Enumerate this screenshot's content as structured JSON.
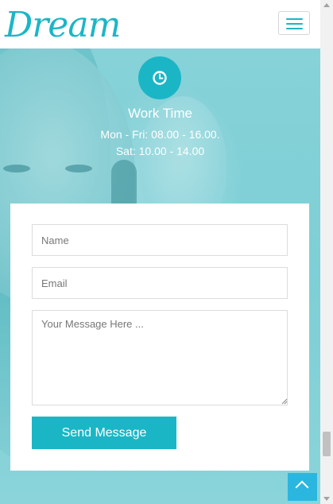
{
  "header": {
    "logo_text": "Dream",
    "menu_icon": "hamburger-menu-icon"
  },
  "info": {
    "icon": "clock-icon",
    "title": "Work Time",
    "line1": "Mon - Fri: 08.00 - 16.00.",
    "line2": "Sat: 10.00 - 14.00"
  },
  "form": {
    "name_placeholder": "Name",
    "email_placeholder": "Email",
    "message_placeholder": "Your Message Here ...",
    "submit_label": "Send Message"
  },
  "back_to_top": {
    "icon": "chevron-up-icon"
  },
  "colors": {
    "accent": "#1bb6c6",
    "back_to_top": "#2bb6e0"
  }
}
